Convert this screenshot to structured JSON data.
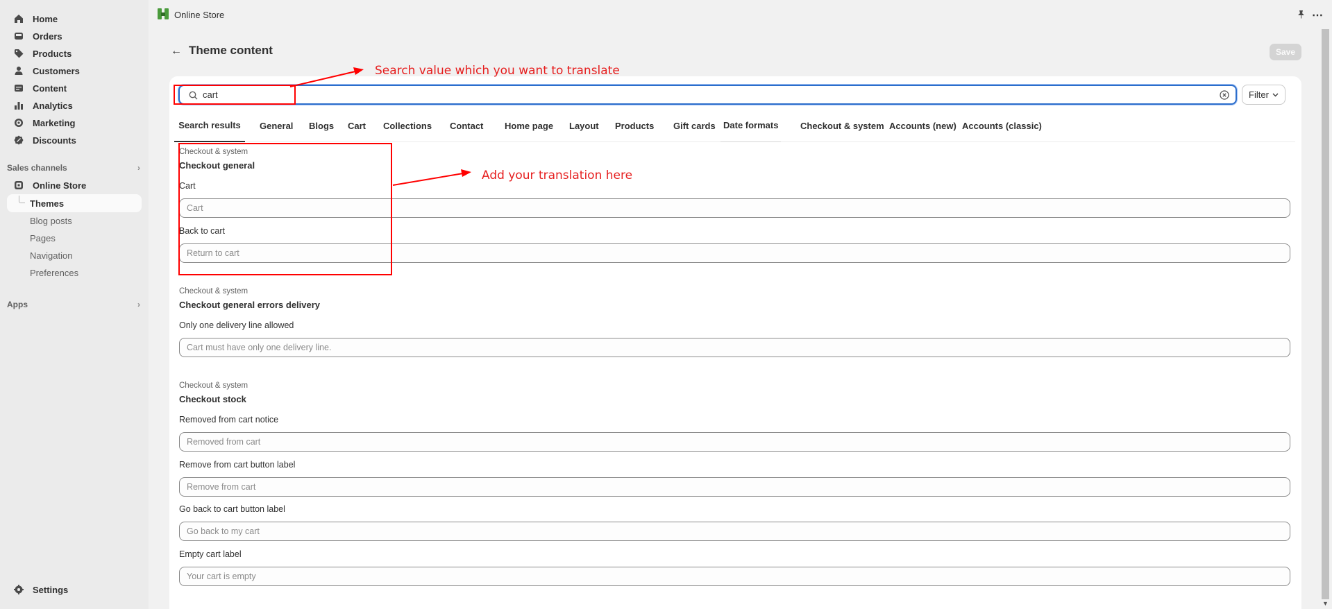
{
  "sidebar": {
    "items": [
      {
        "label": "Home",
        "icon": "home-icon"
      },
      {
        "label": "Orders",
        "icon": "inbox-icon"
      },
      {
        "label": "Products",
        "icon": "tag-icon"
      },
      {
        "label": "Customers",
        "icon": "person-icon"
      },
      {
        "label": "Content",
        "icon": "content-icon"
      },
      {
        "label": "Analytics",
        "icon": "bar-chart-icon"
      },
      {
        "label": "Marketing",
        "icon": "target-icon"
      },
      {
        "label": "Discounts",
        "icon": "discount-icon"
      }
    ],
    "sales_channels_label": "Sales channels",
    "online_store_label": "Online Store",
    "sub_items": [
      "Themes",
      "Blog posts",
      "Pages",
      "Navigation",
      "Preferences"
    ],
    "apps_label": "Apps",
    "settings_label": "Settings"
  },
  "topbar": {
    "title": "Online Store"
  },
  "header": {
    "title": "Theme content",
    "save_label": "Save"
  },
  "search": {
    "value": "cart",
    "filter_label": "Filter"
  },
  "tabs": [
    "Search results",
    "General",
    "Blogs",
    "Cart",
    "Collections",
    "Contact",
    "Home page",
    "Layout",
    "Products",
    "Gift cards",
    "Date formats",
    "Checkout & system",
    "Accounts (new)",
    "Accounts (classic)"
  ],
  "sections": [
    {
      "crumb": "Checkout & system",
      "title": "Checkout general",
      "fields": [
        {
          "label": "Cart",
          "placeholder": "Cart"
        },
        {
          "label": "Back to cart",
          "placeholder": "Return to cart"
        }
      ]
    },
    {
      "crumb": "Checkout & system",
      "title": "Checkout general errors delivery",
      "fields": [
        {
          "label": "Only one delivery line allowed",
          "placeholder": "Cart must have only one delivery line."
        }
      ]
    },
    {
      "crumb": "Checkout & system",
      "title": "Checkout stock",
      "fields": [
        {
          "label": "Removed from cart notice",
          "placeholder": "Removed from cart"
        },
        {
          "label": "Remove from cart button label",
          "placeholder": "Remove from cart"
        },
        {
          "label": "Go back to cart button label",
          "placeholder": "Go back to my cart"
        },
        {
          "label": "Empty cart label",
          "placeholder": "Your cart is empty"
        }
      ]
    }
  ],
  "annotations": {
    "search_note": "Search value which you want to translate",
    "translation_note": "Add your translation here",
    "color": "#ff0000"
  }
}
